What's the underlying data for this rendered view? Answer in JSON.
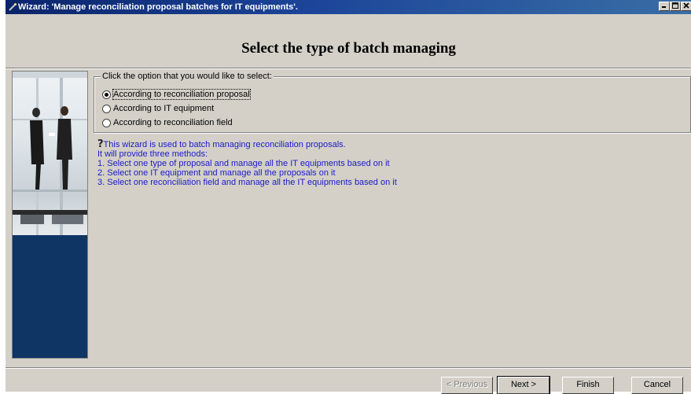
{
  "window": {
    "title": "Wizard: 'Manage reconciliation proposal batches for IT equipments'.",
    "controls": {
      "minimize": "_",
      "maximize": "□",
      "close": "×"
    }
  },
  "header": {
    "title": "Select the type of batch managing"
  },
  "options_group": {
    "legend": "Click the option that you would like to select:",
    "options": [
      {
        "label": "According to reconciliation proposal",
        "selected": true
      },
      {
        "label": "According to IT equipment",
        "selected": false
      },
      {
        "label": "According to reconciliation field",
        "selected": false
      }
    ]
  },
  "info": {
    "lines": [
      "This wizard is used to batch managing reconciliation proposals.",
      "It will provide three methods:",
      "1. Select one type of proposal and manage all the IT equipments based on it",
      "2. Select one IT equipment and manage all the proposals on it",
      "3. Select one reconciliation field and manage all the IT equipments based on it"
    ]
  },
  "buttons": {
    "previous": "< Previous",
    "next": "Next >",
    "finish": "Finish",
    "cancel": "Cancel"
  }
}
